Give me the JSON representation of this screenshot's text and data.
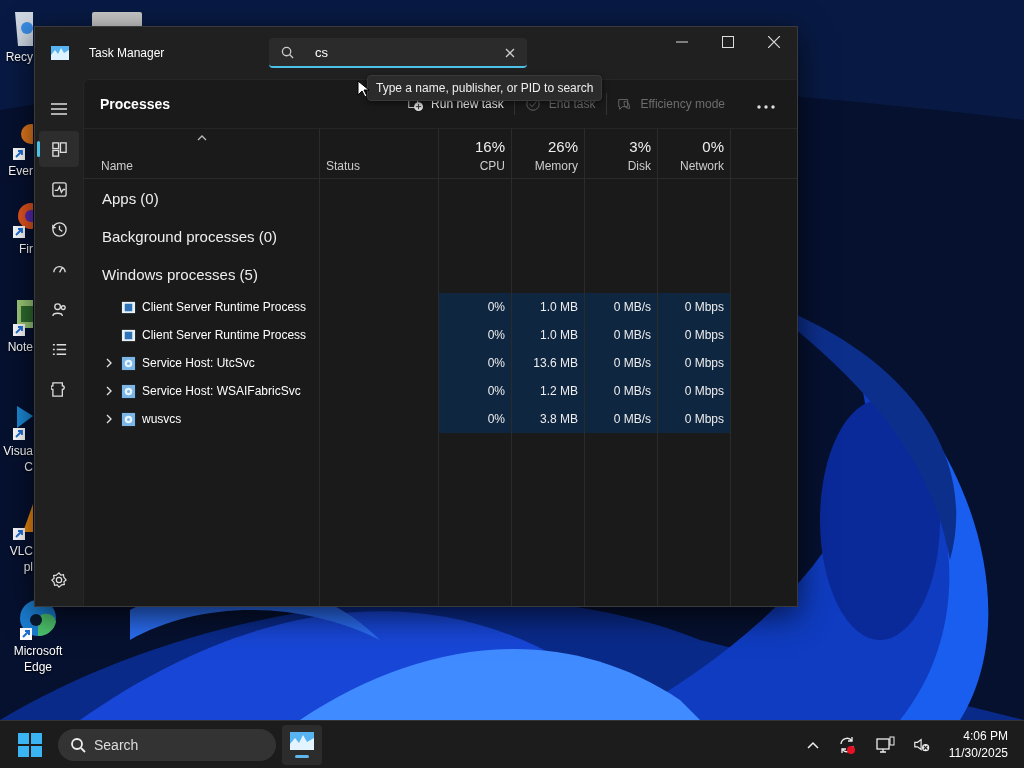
{
  "desktop_icons": [
    {
      "kind": "recycle",
      "label_lines": [
        "Recy"
      ]
    },
    {
      "kind": "shortcut-orange",
      "label_lines": [
        "Ever"
      ]
    },
    {
      "kind": "shortcut-fox",
      "label_lines": [
        "Fir"
      ]
    },
    {
      "kind": "shortcut-note",
      "label_lines": [
        "Note"
      ]
    },
    {
      "kind": "shortcut-code",
      "label_lines": [
        "Visua",
        "C"
      ]
    },
    {
      "kind": "shortcut-cone",
      "label_lines": [
        "VLC",
        "pl"
      ]
    },
    {
      "kind": "edge",
      "label_lines": [
        "Microsoft",
        "Edge"
      ]
    }
  ],
  "window": {
    "title": "Task Manager",
    "search": {
      "value": "cs"
    },
    "tooltip": "Type a name, publisher, or PID to search",
    "nav": [
      {
        "kind": "processes",
        "selected": true
      },
      {
        "kind": "performance",
        "selected": false
      },
      {
        "kind": "history",
        "selected": false
      },
      {
        "kind": "startup",
        "selected": false
      },
      {
        "kind": "users",
        "selected": false
      },
      {
        "kind": "details",
        "selected": false
      },
      {
        "kind": "services",
        "selected": false
      }
    ],
    "page_title": "Processes",
    "toolbar": [
      {
        "kind": "run",
        "label": "Run new task",
        "disabled": false
      },
      {
        "kind": "end",
        "label": "End task",
        "disabled": true
      },
      {
        "kind": "efficiency",
        "label": "Efficiency mode",
        "disabled": true
      }
    ],
    "columns": [
      {
        "label": "Name",
        "sorted": true
      },
      {
        "label": "Status",
        "sorted": false
      },
      {
        "usage": "16%",
        "label": "CPU",
        "sorted": false
      },
      {
        "usage": "26%",
        "label": "Memory",
        "sorted": false
      },
      {
        "usage": "3%",
        "label": "Disk",
        "sorted": false
      },
      {
        "usage": "0%",
        "label": "Network",
        "sorted": false
      }
    ],
    "groups": [
      {
        "label": "Apps (0)"
      },
      {
        "label": "Background processes (0)"
      },
      {
        "label": "Windows processes (5)",
        "processes": [
          {
            "name": "Client Server Runtime Process",
            "kind": "window",
            "expandable": false,
            "cpu": "0%",
            "memory": "1.0 MB",
            "disk": "0 MB/s",
            "network": "0 Mbps"
          },
          {
            "name": "Client Server Runtime Process",
            "kind": "window",
            "expandable": false,
            "cpu": "0%",
            "memory": "1.0 MB",
            "disk": "0 MB/s",
            "network": "0 Mbps"
          },
          {
            "name": "Service Host: UtcSvc",
            "kind": "service",
            "expandable": true,
            "cpu": "0%",
            "memory": "13.6 MB",
            "disk": "0 MB/s",
            "network": "0 Mbps"
          },
          {
            "name": "Service Host: WSAIFabricSvc",
            "kind": "service",
            "expandable": true,
            "cpu": "0%",
            "memory": "1.2 MB",
            "disk": "0 MB/s",
            "network": "0 Mbps"
          },
          {
            "name": "wusvcs",
            "kind": "service",
            "expandable": true,
            "cpu": "0%",
            "memory": "3.8 MB",
            "disk": "0 MB/s",
            "network": "0 Mbps"
          }
        ]
      }
    ]
  },
  "taskbar": {
    "search": {
      "placeholder": "Search"
    },
    "apps": [
      {
        "kind": "task-manager",
        "selected": true
      }
    ],
    "time": "4:06 PM",
    "date": "11/30/2025"
  }
}
